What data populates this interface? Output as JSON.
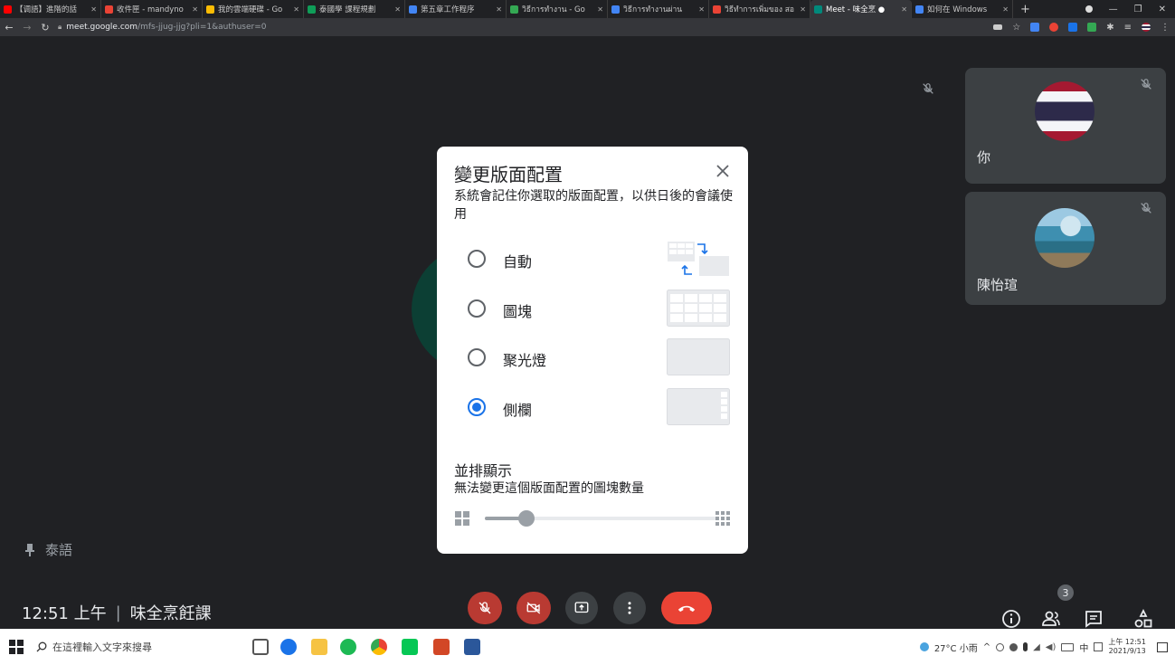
{
  "browser": {
    "tabs": [
      {
        "title": "【调語】進階的話",
        "color": "#ff0000"
      },
      {
        "title": "收件匣 - mandyno",
        "color": "#ea4335"
      },
      {
        "title": "我的雲端硬碟 - Go",
        "color": "#fbbc04"
      },
      {
        "title": "泰國學 課程規劃",
        "color": "#0f9d58"
      },
      {
        "title": "第五章工作程序",
        "color": "#4285f4"
      },
      {
        "title": "วิธีการทำงาน - Go",
        "color": "#34a853"
      },
      {
        "title": "วิธีการทำงานผ่าน",
        "color": "#4285f4"
      },
      {
        "title": "วิธีทำการเพิ่มของ สอ",
        "color": "#ea4335"
      },
      {
        "title": "Meet - 味全烹 ●",
        "color": "#00897b",
        "active": true
      },
      {
        "title": "如何在 Windows",
        "color": "#4285f4"
      }
    ],
    "new_tab": "+",
    "url_host": "meet.google.com",
    "url_path": "/mfs-jjug-jjg?pli=1&authuser=0"
  },
  "meeting": {
    "pinned_label": "泰語",
    "time": "12:51 上午",
    "separator": "|",
    "title": "味全烹飪課",
    "people_count": "3",
    "tiles": [
      {
        "name": "你"
      },
      {
        "name": "陳怡瑄"
      }
    ]
  },
  "dialog": {
    "title": "變更版面配置",
    "description": "系統會記住你選取的版面配置，以供日後的會議使用",
    "options": [
      {
        "label": "自動",
        "selected": false
      },
      {
        "label": "圖塊",
        "selected": false
      },
      {
        "label": "聚光燈",
        "selected": false
      },
      {
        "label": "側欄",
        "selected": true
      }
    ],
    "tiles_section": {
      "title": "並排顯示",
      "description": "無法變更這個版面配置的圖塊數量",
      "slider_value": 0.18
    }
  },
  "taskbar": {
    "search_placeholder": "在這裡輸入文字來搜尋",
    "weather": "27°C 小雨",
    "ime": "中",
    "clock_time": "上午 12:51",
    "clock_date": "2021/9/13"
  },
  "colors": {
    "accent": "#1a73e8",
    "end_call": "#ea4335",
    "muted_red": "#b93a32"
  }
}
